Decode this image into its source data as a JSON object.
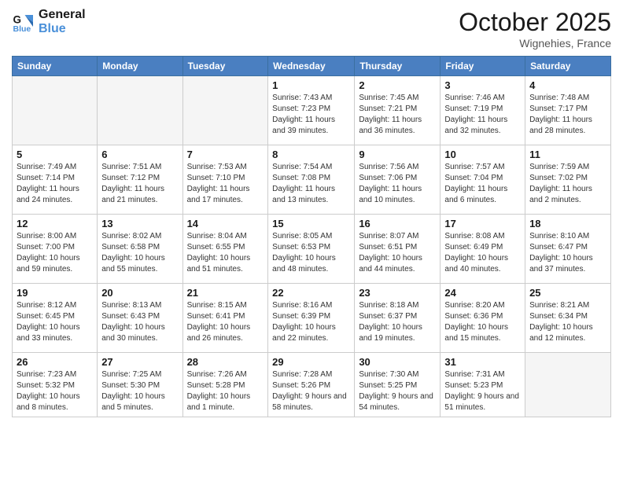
{
  "header": {
    "logo_line1": "General",
    "logo_line2": "Blue",
    "month_title": "October 2025",
    "location": "Wignehies, France"
  },
  "weekdays": [
    "Sunday",
    "Monday",
    "Tuesday",
    "Wednesday",
    "Thursday",
    "Friday",
    "Saturday"
  ],
  "weeks": [
    [
      {
        "day": "",
        "sunrise": "",
        "sunset": "",
        "daylight": "",
        "empty": true
      },
      {
        "day": "",
        "sunrise": "",
        "sunset": "",
        "daylight": "",
        "empty": true
      },
      {
        "day": "",
        "sunrise": "",
        "sunset": "",
        "daylight": "",
        "empty": true
      },
      {
        "day": "1",
        "sunrise": "Sunrise: 7:43 AM",
        "sunset": "Sunset: 7:23 PM",
        "daylight": "Daylight: 11 hours and 39 minutes.",
        "empty": false
      },
      {
        "day": "2",
        "sunrise": "Sunrise: 7:45 AM",
        "sunset": "Sunset: 7:21 PM",
        "daylight": "Daylight: 11 hours and 36 minutes.",
        "empty": false
      },
      {
        "day": "3",
        "sunrise": "Sunrise: 7:46 AM",
        "sunset": "Sunset: 7:19 PM",
        "daylight": "Daylight: 11 hours and 32 minutes.",
        "empty": false
      },
      {
        "day": "4",
        "sunrise": "Sunrise: 7:48 AM",
        "sunset": "Sunset: 7:17 PM",
        "daylight": "Daylight: 11 hours and 28 minutes.",
        "empty": false
      }
    ],
    [
      {
        "day": "5",
        "sunrise": "Sunrise: 7:49 AM",
        "sunset": "Sunset: 7:14 PM",
        "daylight": "Daylight: 11 hours and 24 minutes.",
        "empty": false
      },
      {
        "day": "6",
        "sunrise": "Sunrise: 7:51 AM",
        "sunset": "Sunset: 7:12 PM",
        "daylight": "Daylight: 11 hours and 21 minutes.",
        "empty": false
      },
      {
        "day": "7",
        "sunrise": "Sunrise: 7:53 AM",
        "sunset": "Sunset: 7:10 PM",
        "daylight": "Daylight: 11 hours and 17 minutes.",
        "empty": false
      },
      {
        "day": "8",
        "sunrise": "Sunrise: 7:54 AM",
        "sunset": "Sunset: 7:08 PM",
        "daylight": "Daylight: 11 hours and 13 minutes.",
        "empty": false
      },
      {
        "day": "9",
        "sunrise": "Sunrise: 7:56 AM",
        "sunset": "Sunset: 7:06 PM",
        "daylight": "Daylight: 11 hours and 10 minutes.",
        "empty": false
      },
      {
        "day": "10",
        "sunrise": "Sunrise: 7:57 AM",
        "sunset": "Sunset: 7:04 PM",
        "daylight": "Daylight: 11 hours and 6 minutes.",
        "empty": false
      },
      {
        "day": "11",
        "sunrise": "Sunrise: 7:59 AM",
        "sunset": "Sunset: 7:02 PM",
        "daylight": "Daylight: 11 hours and 2 minutes.",
        "empty": false
      }
    ],
    [
      {
        "day": "12",
        "sunrise": "Sunrise: 8:00 AM",
        "sunset": "Sunset: 7:00 PM",
        "daylight": "Daylight: 10 hours and 59 minutes.",
        "empty": false
      },
      {
        "day": "13",
        "sunrise": "Sunrise: 8:02 AM",
        "sunset": "Sunset: 6:58 PM",
        "daylight": "Daylight: 10 hours and 55 minutes.",
        "empty": false
      },
      {
        "day": "14",
        "sunrise": "Sunrise: 8:04 AM",
        "sunset": "Sunset: 6:55 PM",
        "daylight": "Daylight: 10 hours and 51 minutes.",
        "empty": false
      },
      {
        "day": "15",
        "sunrise": "Sunrise: 8:05 AM",
        "sunset": "Sunset: 6:53 PM",
        "daylight": "Daylight: 10 hours and 48 minutes.",
        "empty": false
      },
      {
        "day": "16",
        "sunrise": "Sunrise: 8:07 AM",
        "sunset": "Sunset: 6:51 PM",
        "daylight": "Daylight: 10 hours and 44 minutes.",
        "empty": false
      },
      {
        "day": "17",
        "sunrise": "Sunrise: 8:08 AM",
        "sunset": "Sunset: 6:49 PM",
        "daylight": "Daylight: 10 hours and 40 minutes.",
        "empty": false
      },
      {
        "day": "18",
        "sunrise": "Sunrise: 8:10 AM",
        "sunset": "Sunset: 6:47 PM",
        "daylight": "Daylight: 10 hours and 37 minutes.",
        "empty": false
      }
    ],
    [
      {
        "day": "19",
        "sunrise": "Sunrise: 8:12 AM",
        "sunset": "Sunset: 6:45 PM",
        "daylight": "Daylight: 10 hours and 33 minutes.",
        "empty": false
      },
      {
        "day": "20",
        "sunrise": "Sunrise: 8:13 AM",
        "sunset": "Sunset: 6:43 PM",
        "daylight": "Daylight: 10 hours and 30 minutes.",
        "empty": false
      },
      {
        "day": "21",
        "sunrise": "Sunrise: 8:15 AM",
        "sunset": "Sunset: 6:41 PM",
        "daylight": "Daylight: 10 hours and 26 minutes.",
        "empty": false
      },
      {
        "day": "22",
        "sunrise": "Sunrise: 8:16 AM",
        "sunset": "Sunset: 6:39 PM",
        "daylight": "Daylight: 10 hours and 22 minutes.",
        "empty": false
      },
      {
        "day": "23",
        "sunrise": "Sunrise: 8:18 AM",
        "sunset": "Sunset: 6:37 PM",
        "daylight": "Daylight: 10 hours and 19 minutes.",
        "empty": false
      },
      {
        "day": "24",
        "sunrise": "Sunrise: 8:20 AM",
        "sunset": "Sunset: 6:36 PM",
        "daylight": "Daylight: 10 hours and 15 minutes.",
        "empty": false
      },
      {
        "day": "25",
        "sunrise": "Sunrise: 8:21 AM",
        "sunset": "Sunset: 6:34 PM",
        "daylight": "Daylight: 10 hours and 12 minutes.",
        "empty": false
      }
    ],
    [
      {
        "day": "26",
        "sunrise": "Sunrise: 7:23 AM",
        "sunset": "Sunset: 5:32 PM",
        "daylight": "Daylight: 10 hours and 8 minutes.",
        "empty": false
      },
      {
        "day": "27",
        "sunrise": "Sunrise: 7:25 AM",
        "sunset": "Sunset: 5:30 PM",
        "daylight": "Daylight: 10 hours and 5 minutes.",
        "empty": false
      },
      {
        "day": "28",
        "sunrise": "Sunrise: 7:26 AM",
        "sunset": "Sunset: 5:28 PM",
        "daylight": "Daylight: 10 hours and 1 minute.",
        "empty": false
      },
      {
        "day": "29",
        "sunrise": "Sunrise: 7:28 AM",
        "sunset": "Sunset: 5:26 PM",
        "daylight": "Daylight: 9 hours and 58 minutes.",
        "empty": false
      },
      {
        "day": "30",
        "sunrise": "Sunrise: 7:30 AM",
        "sunset": "Sunset: 5:25 PM",
        "daylight": "Daylight: 9 hours and 54 minutes.",
        "empty": false
      },
      {
        "day": "31",
        "sunrise": "Sunrise: 7:31 AM",
        "sunset": "Sunset: 5:23 PM",
        "daylight": "Daylight: 9 hours and 51 minutes.",
        "empty": false
      },
      {
        "day": "",
        "sunrise": "",
        "sunset": "",
        "daylight": "",
        "empty": true
      }
    ]
  ]
}
